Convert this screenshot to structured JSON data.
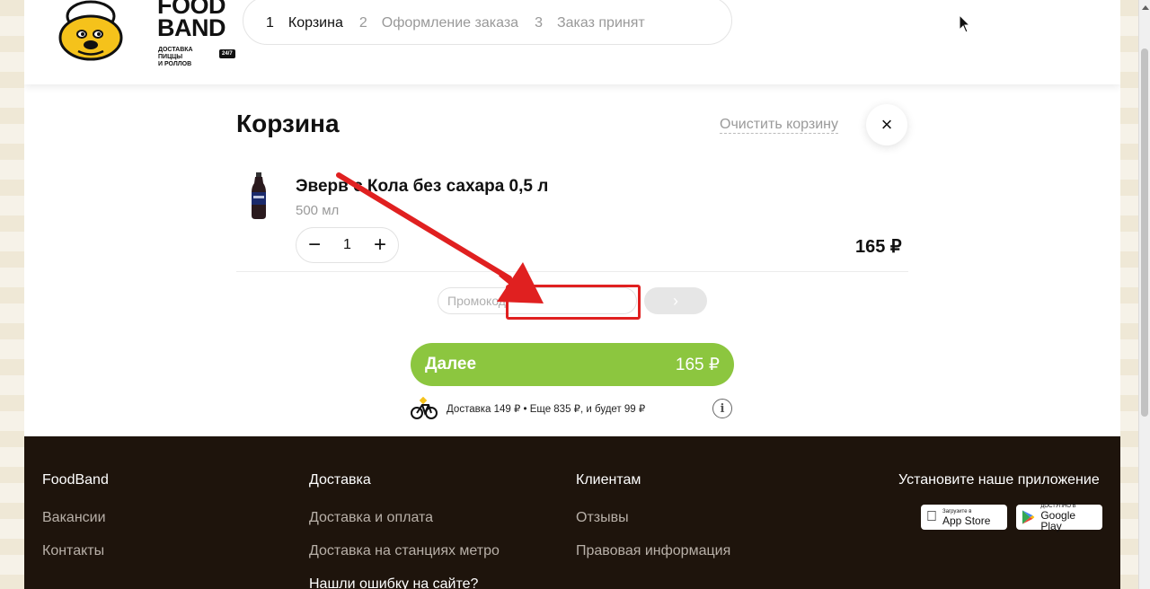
{
  "header": {
    "logo": {
      "line1": "FOOD",
      "line2": "BAND",
      "subtitle_line1": "ДОСТАВКА ПИЦЦЫ",
      "subtitle_line2": "И РОЛЛОВ",
      "badge": "24/7"
    },
    "steps": [
      {
        "num": "1",
        "label": "Корзина",
        "active": true
      },
      {
        "num": "2",
        "label": "Оформление заказа",
        "active": false
      },
      {
        "num": "3",
        "label": "Заказ принят",
        "active": false
      }
    ]
  },
  "cart": {
    "title": "Корзина",
    "clear_label": "Очистить корзину",
    "close_icon": "×",
    "item": {
      "name": "Эверв    с Кола без сахара 0,5 л",
      "size": "500 мл",
      "quantity": "1",
      "minus": "−",
      "plus": "+",
      "price": "165 ₽"
    },
    "promo": {
      "placeholder": "Промокод",
      "button_icon": "›"
    },
    "next": {
      "label": "Далее",
      "total": "165 ₽"
    },
    "delivery": {
      "text": "Доставка 149 ₽ • Еще 835 ₽, и будет 99 ₽",
      "info_icon": "i"
    }
  },
  "footer": {
    "col1": {
      "head": "FoodBand",
      "links": [
        "Вакансии",
        "Контакты"
      ]
    },
    "col2": {
      "head": "Доставка",
      "links": [
        "Доставка и оплата",
        "Доставка на станциях метро"
      ],
      "extra": "Нашли ошибку на сайте?"
    },
    "col3": {
      "head": "Клиентам",
      "links": [
        "Отзывы",
        "Правовая информация"
      ]
    },
    "apps": {
      "head": "Установите наше приложение",
      "appstore_small": "Загрузите в",
      "appstore_big": "App Store",
      "googleplay_small": "ДОСТУПНО В",
      "googleplay_big": "Google Play"
    }
  },
  "colors": {
    "accent_green": "#8cc63f",
    "footer_bg": "#1e140c",
    "annotation_red": "#e02020"
  }
}
